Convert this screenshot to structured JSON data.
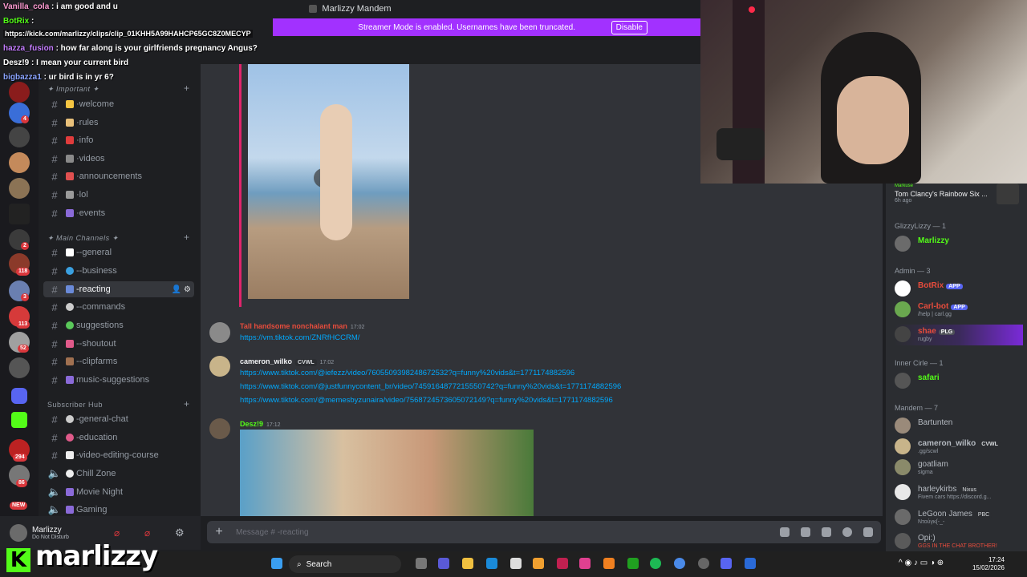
{
  "window": {
    "title": "Marlizzy Mandem"
  },
  "streamer_banner": {
    "text": "Streamer Mode is enabled. Usernames have been truncated.",
    "button": "Disable"
  },
  "overlay_chat": [
    {
      "user": "Vanilla_cola",
      "text": ": i am good and u",
      "color": "#ff9bd2"
    },
    {
      "user": "BotRix",
      "text": ":",
      "color": "#53fc18"
    },
    {
      "user": "",
      "text": "https://kick.com/marlizzy/clips/clip_01KHH5A99HAHCP65GC8Z0MECYP",
      "color": "#ffffff"
    },
    {
      "user": "hazza_fusion",
      "text": ": how far along is your girlfriends pregnancy Angus?",
      "color": "#c47cff"
    },
    {
      "user": "Desz!9",
      "text": ": I mean your current bird",
      "color": "#ffffff"
    },
    {
      "user": "bigbazza1",
      "text": ": ur bird is in yr 6?",
      "color": "#8aa4ff"
    }
  ],
  "server_badges": [
    "4",
    "2",
    "118",
    "3",
    "113",
    "52",
    "294",
    "86",
    "NEW"
  ],
  "sidebar": {
    "category_important": "✦ Important ✦",
    "important_channels": [
      "·welcome",
      "·rules",
      "·info",
      "·videos",
      "·announcements",
      "·lol",
      "·events"
    ],
    "category_main": "✦ Main Channels ✦",
    "main_channels": [
      "--general",
      "--business",
      "-reacting",
      "--commands",
      "suggestions",
      "--shoutout",
      "--clipfarms",
      "music-suggestions"
    ],
    "category_sub": "Subscriber Hub",
    "sub_channels": [
      "-general-chat",
      "-education",
      "-video-editing-course"
    ],
    "voice_channels": [
      "Chill Zone",
      "Movie Night",
      "Gaming"
    ]
  },
  "user_area": {
    "name": "Marlizzy",
    "status": "Do Not Disturb"
  },
  "messages": [
    {
      "author": "Tall handsome nonchalant man",
      "time": "17:02",
      "color": "#e74c3c",
      "lines": [
        "https://vm.tiktok.com/ZNRfHCCRM/"
      ]
    },
    {
      "author": "cameron_wilko",
      "tag": "CVWL",
      "time": "17:02",
      "color": "#f2f3f5",
      "lines": [
        "https://www.tiktok.com/@iefezz/video/7605509398248672532?q=funny%20vids&t=1771174882596",
        "https://www.tiktok.com/@justfunnycontent_br/video/7459164877215550742?q=funny%20vids&t=1771174882596",
        "https://www.tiktok.com/@memesbyzunaira/video/7568724573605072149?q=funny%20vids&t=1771174882596"
      ]
    },
    {
      "author": "Desz!9",
      "time": "17:12",
      "color": "#53fc18",
      "lines": []
    }
  ],
  "composer": {
    "placeholder": "Message # -reacting"
  },
  "members": {
    "activity": {
      "user": "Markuse",
      "game": "Tom Clancy's Rainbow Six ...",
      "time": "6h ago"
    },
    "groups": [
      {
        "title": "GlizzyLizzy — 1",
        "items": [
          {
            "name": "Marlizzy",
            "color": "#53fc18",
            "sub": ""
          }
        ]
      },
      {
        "title": "Admin — 3",
        "items": [
          {
            "name": "BotRix",
            "color": "#e74c3c",
            "sub": "",
            "app": "APP"
          },
          {
            "name": "Carl-bot",
            "color": "#e74c3c",
            "sub": "/help | carl.gg",
            "app": "APP"
          },
          {
            "name": "shae",
            "color": "#e74c3c",
            "sub": "rugby",
            "app": "PLG"
          }
        ]
      },
      {
        "title": "Inner Cirle — 1",
        "items": [
          {
            "name": "safari",
            "color": "#53fc18",
            "sub": ""
          }
        ]
      },
      {
        "title": "Mandem — 7",
        "items": [
          {
            "name": "Bartunten",
            "color": "#b5bac1",
            "sub": ""
          },
          {
            "name": "cameron_wilko",
            "color": "#b5bac1",
            "sub": ".gg/scwl",
            "app": "CVWL"
          },
          {
            "name": "goatliam",
            "color": "#b5bac1",
            "sub": "sigma"
          },
          {
            "name": "harleykirbs",
            "color": "#b5bac1",
            "sub": "Fivem cars https://discord.g...",
            "app": "Nixus"
          },
          {
            "name": "LeGoon James",
            "color": "#b5bac1",
            "sub": "Ντούγκ{-_-",
            "app": "PBC"
          },
          {
            "name": "Opi:)",
            "color": "#b5bac1",
            "sub": "GGS IN THE CHAT BROTHER!"
          }
        ]
      }
    ]
  },
  "stream_name": "marlizzy",
  "taskbar": {
    "search": "Search",
    "time": "17:24",
    "date": "15/02/2026"
  }
}
